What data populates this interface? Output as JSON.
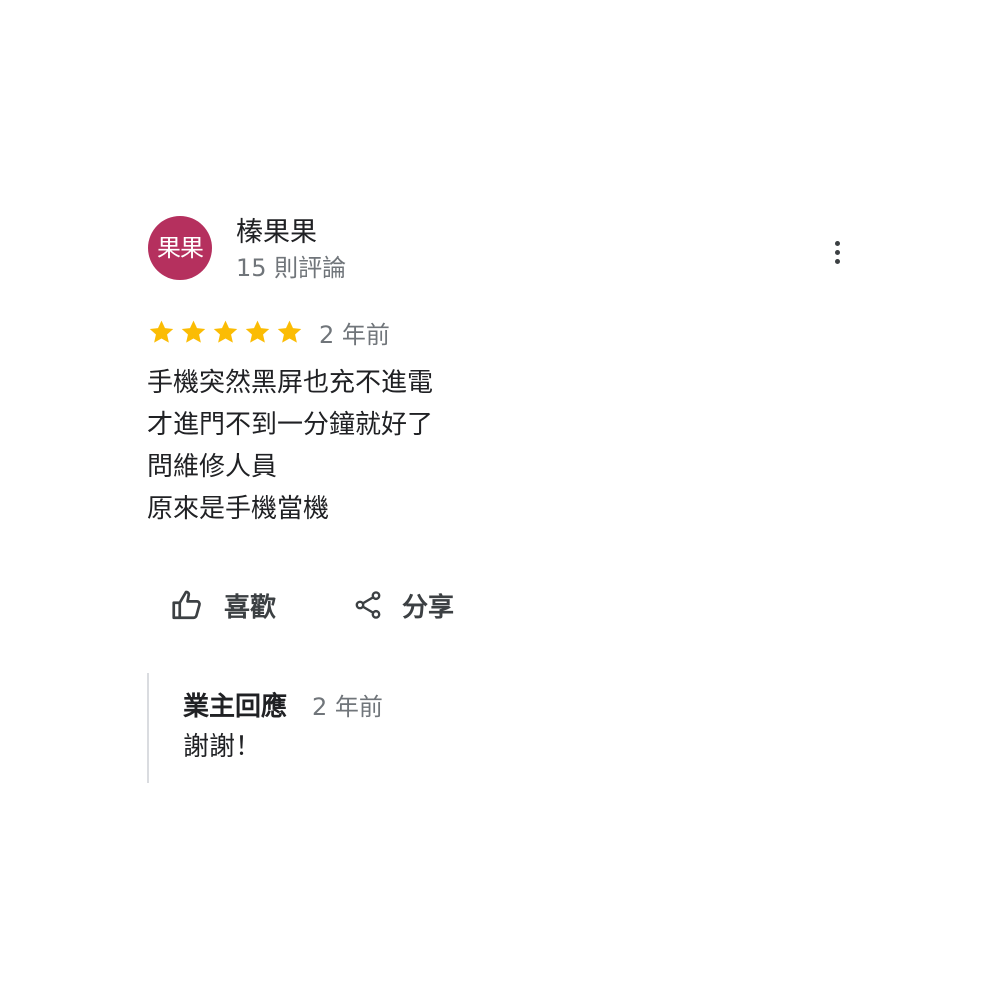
{
  "colors": {
    "avatar_bg": "#B5305E",
    "star": "#FBBC04",
    "text_primary": "#202124",
    "text_secondary": "#70757A",
    "icon": "#3C4043",
    "divider": "#DADCE0"
  },
  "review": {
    "avatar_text": "果果",
    "author_name": "榛果果",
    "author_review_count": "15 則評論",
    "rating": 5,
    "time": "2 年前",
    "text_lines": [
      "手機突然黑屏也充不進電",
      "才進門不到一分鐘就好了",
      "問維修人員",
      "原來是手機當機"
    ],
    "actions": {
      "like_label": "喜歡",
      "share_label": "分享"
    },
    "owner_response": {
      "label": "業主回應",
      "time": "2 年前",
      "text": "謝謝！"
    }
  },
  "icons": {
    "more": "more-vert-icon",
    "star": "star-icon",
    "like": "thumb-up-icon",
    "share": "share-icon"
  }
}
